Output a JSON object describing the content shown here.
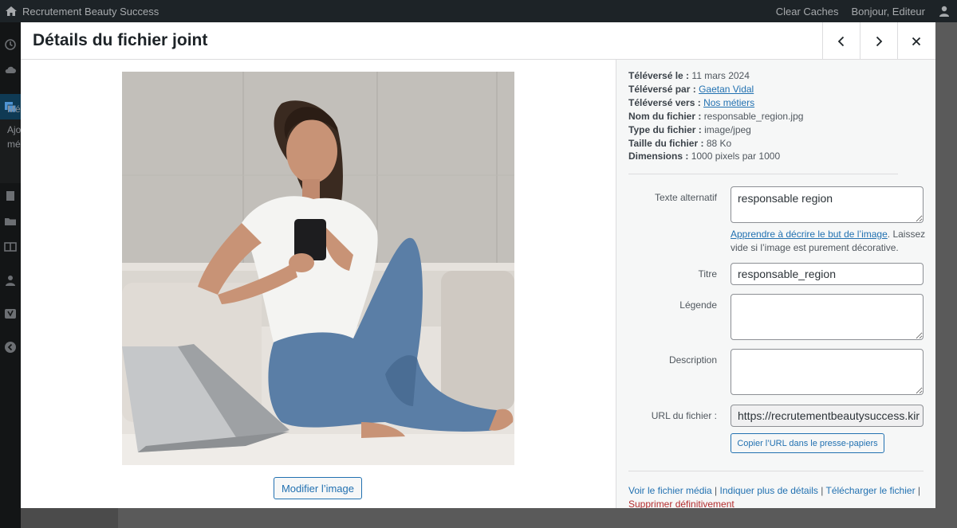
{
  "adminbar": {
    "site_title": "Recrutement Beauty Success",
    "clear_caches": "Clear Caches",
    "greeting": "Bonjour, Editeur"
  },
  "sidebar_partial": {
    "label1": "Mé",
    "label2": "Ajo",
    "label3": "mé"
  },
  "modal": {
    "title": "Détails du fichier joint",
    "prev_label": "Précédent",
    "next_label": "Suivant",
    "close_label": "Fermer"
  },
  "media": {
    "edit_image_label": "Modifier l’image"
  },
  "details": {
    "uploaded_on_label": "Téléversé le :",
    "uploaded_on": "11 mars 2024",
    "uploaded_by_label": "Téléversé par :",
    "uploaded_by": "Gaetan Vidal",
    "uploaded_to_label": "Téléversé vers :",
    "uploaded_to": "Nos métiers",
    "filename_label": "Nom du fichier :",
    "filename": "responsable_region.jpg",
    "filetype_label": "Type du fichier :",
    "filetype": "image/jpeg",
    "filesize_label": "Taille du fichier :",
    "filesize": "88 Ko",
    "dimensions_label": "Dimensions :",
    "dimensions": "1000 pixels par 1000"
  },
  "form": {
    "alt_label": "Texte alternatif",
    "alt_value": "responsable region",
    "alt_help_link": "Apprendre à décrire le but de l’image",
    "alt_help_text": ". Laissez vide si l’image est purement décorative.",
    "title_label": "Titre",
    "title_value": "responsable_region",
    "caption_label": "Légende",
    "caption_value": "",
    "description_label": "Description",
    "description_value": "",
    "url_label": "URL du fichier :",
    "url_value": "https://recrutementbeautysuccess.kir",
    "copy_url_label": "Copier l’URL dans le presse-papiers"
  },
  "actions": {
    "view": "Voir le fichier média",
    "more_details": "Indiquer plus de détails",
    "download": "Télécharger le fichier",
    "delete": "Supprimer définitivement",
    "separator": " | "
  }
}
